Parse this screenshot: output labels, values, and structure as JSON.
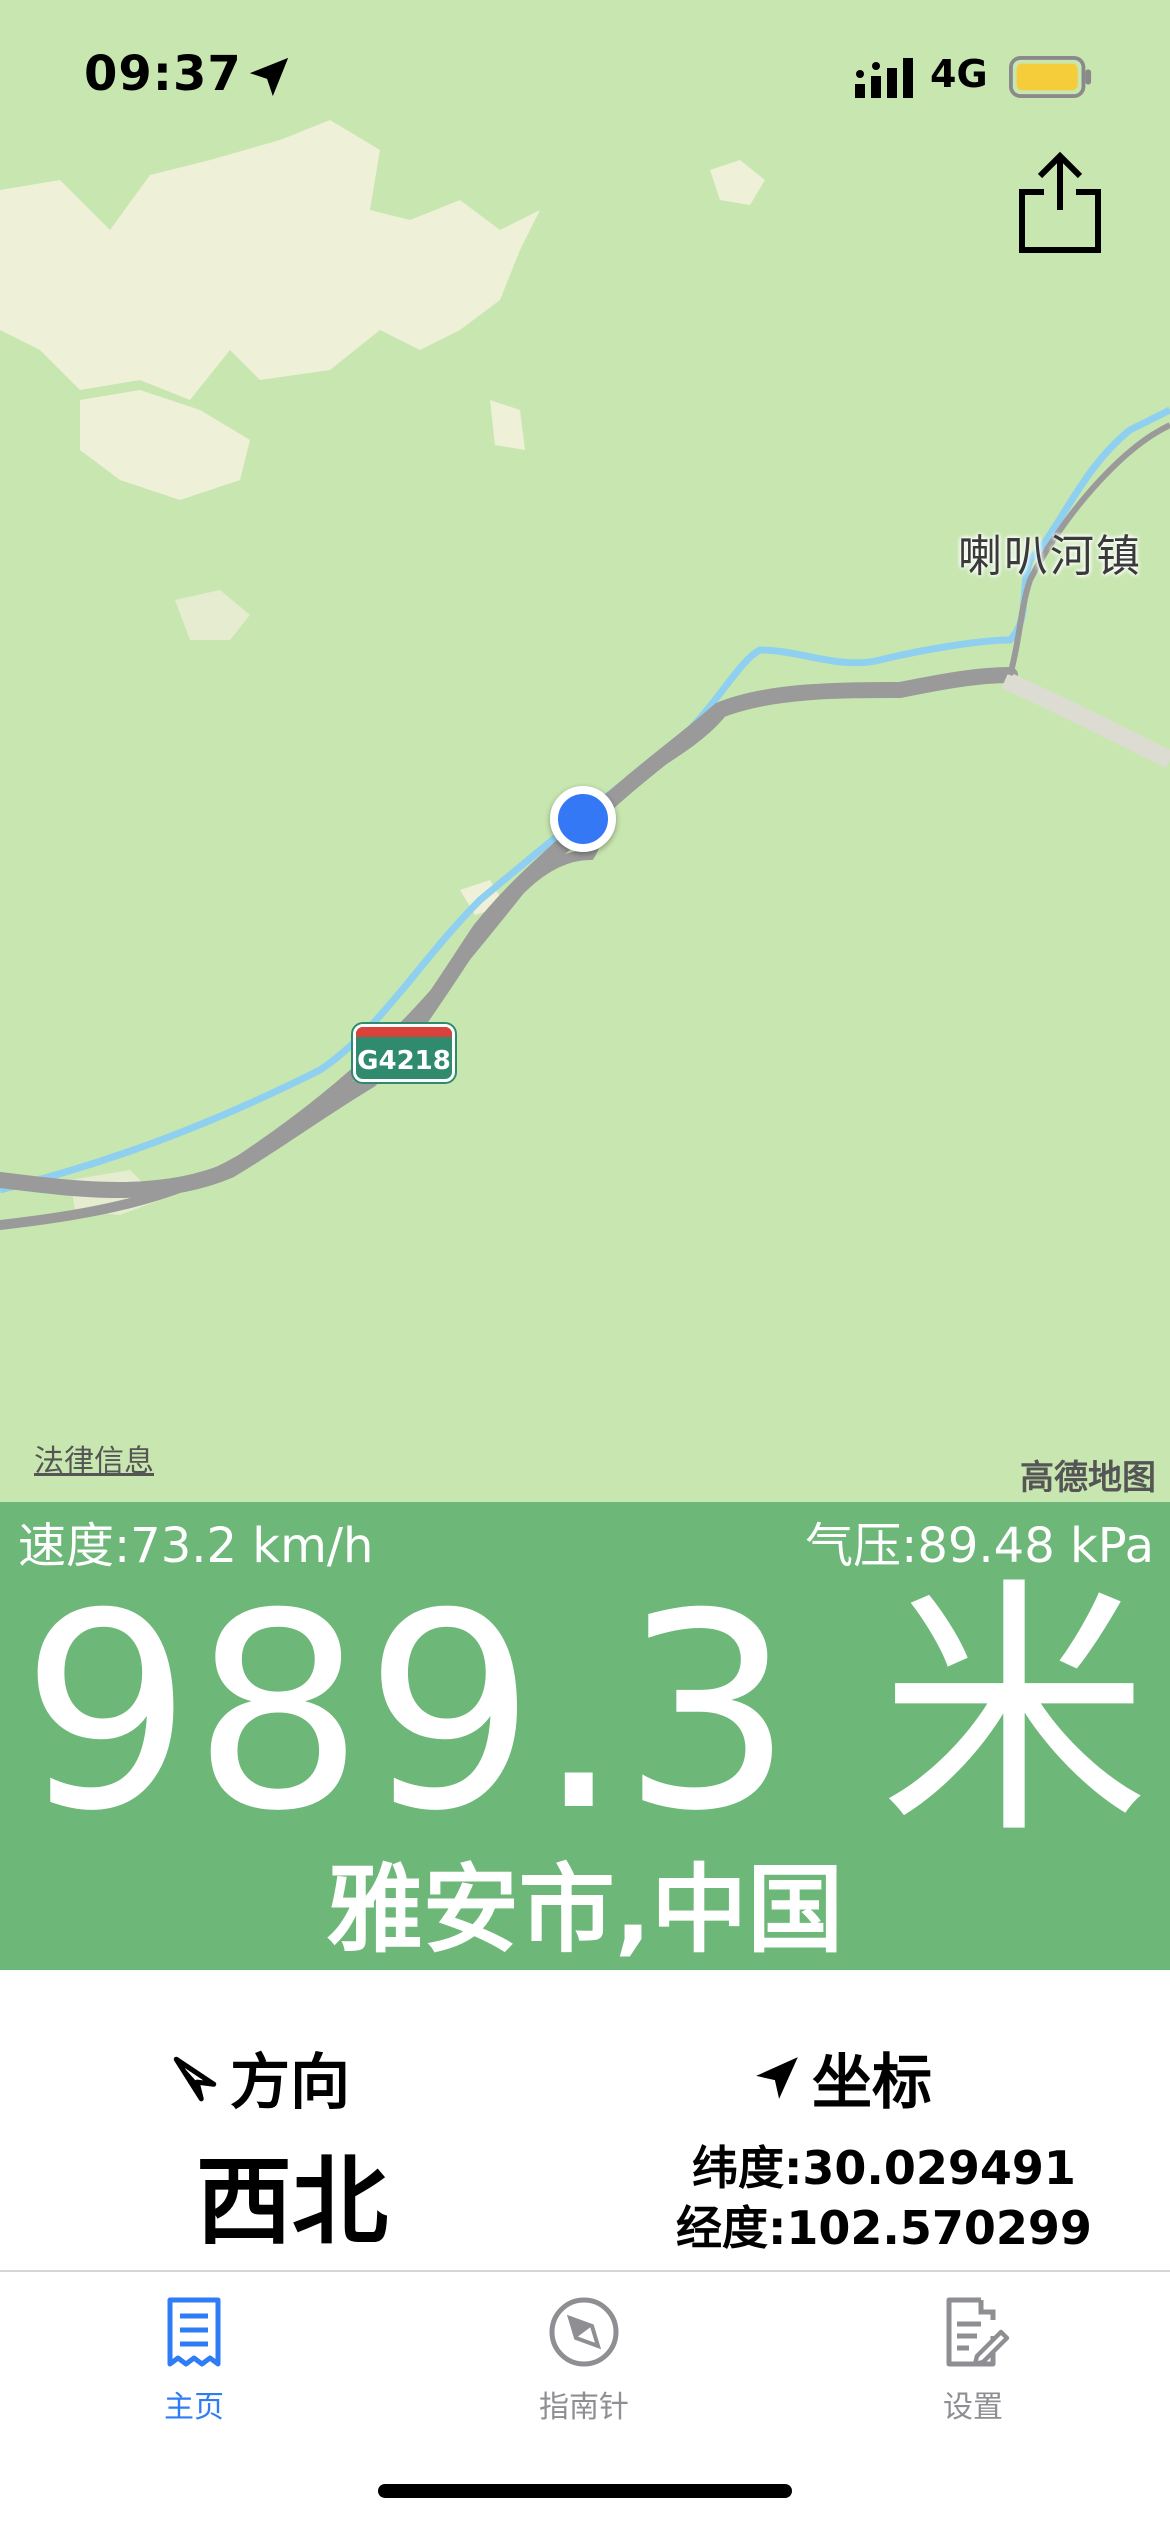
{
  "status_bar": {
    "time": "09:37",
    "network": "4G",
    "battery_color": "#f5cc3a"
  },
  "map": {
    "town_label": "喇叭河镇",
    "road_badge": "G4218",
    "legal_link": "法律信息",
    "brand": "高德地图",
    "colors": {
      "land": "#c8e6b0",
      "river": "#8fd0f0",
      "road": "#9a9a9a",
      "location_dot": "#3478f6"
    }
  },
  "altitude_panel": {
    "speed": "速度:73.2 km/h",
    "pressure": "气压:89.48 kPa",
    "altitude": "989.3 米",
    "city": "雅安市,中国",
    "background": "#6db778"
  },
  "info": {
    "direction_title": "方向",
    "direction_value": "西北",
    "coordinate_title": "坐标",
    "latitude": "纬度:30.029491",
    "longitude": "经度:102.570299"
  },
  "tabs": [
    {
      "label": "主页",
      "icon": "receipt-icon",
      "active": true
    },
    {
      "label": "指南针",
      "icon": "compass-icon",
      "active": false
    },
    {
      "label": "设置",
      "icon": "document-edit-icon",
      "active": false
    }
  ],
  "accent_color": "#2f7cf6"
}
